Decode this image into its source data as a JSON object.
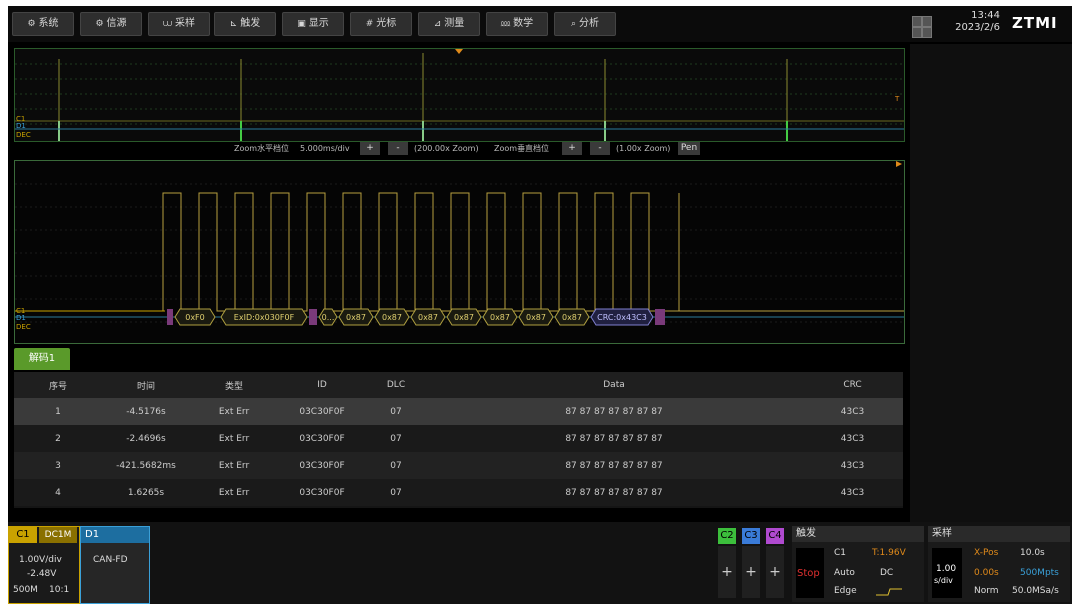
{
  "menu": [
    {
      "icon": "⚙",
      "label": "系统",
      "name": "menu-system"
    },
    {
      "icon": "⚙",
      "label": "信源",
      "name": "menu-source"
    },
    {
      "icon": "⩊",
      "label": "采样",
      "name": "menu-sampling"
    },
    {
      "icon": "⊾",
      "label": "触发",
      "name": "menu-trigger"
    },
    {
      "icon": "▣",
      "label": "显示",
      "name": "menu-display"
    },
    {
      "icon": "#",
      "label": "光标",
      "name": "menu-cursor"
    },
    {
      "icon": "⊿",
      "label": "测量",
      "name": "menu-measure"
    },
    {
      "icon": "⅏",
      "label": "数学",
      "name": "menu-math"
    },
    {
      "icon": "⌕",
      "label": "分析",
      "name": "menu-analysis"
    }
  ],
  "clock": {
    "time": "13:44",
    "date": "2023/2/6"
  },
  "logo": "ZTMI",
  "zoom": {
    "h_label": "Zoom水平档位",
    "h_value": "5.000ms/div",
    "plus": "+",
    "minus": "-",
    "h_factor": "(200.00x Zoom)",
    "v_label": "Zoom垂直档位",
    "v_factor": "(1.00x Zoom)",
    "pen": "Pen"
  },
  "overview": {
    "t_marker": "T"
  },
  "channel_tags": {
    "c1": "C1",
    "d1": "D1",
    "dec": "DEC"
  },
  "decode_segments": [
    "0xF0",
    "ExID:0x030F0F",
    "0...",
    "0x87",
    "0x87",
    "0x87",
    "0x87",
    "0x87",
    "0x87",
    "0x87",
    "CRC:0x43C3"
  ],
  "decode_tab": "解码1",
  "table": {
    "headers": [
      "序号",
      "时间",
      "类型",
      "ID",
      "DLC",
      "Data",
      "CRC"
    ],
    "rows": [
      [
        "1",
        "-4.5176s",
        "Ext Err",
        "03C30F0F",
        "07",
        "87 87 87 87 87 87 87",
        "43C3"
      ],
      [
        "2",
        "-2.4696s",
        "Ext Err",
        "03C30F0F",
        "07",
        "87 87 87 87 87 87 87",
        "43C3"
      ],
      [
        "3",
        "-421.5682ms",
        "Ext Err",
        "03C30F0F",
        "07",
        "87 87 87 87 87 87 87",
        "43C3"
      ],
      [
        "4",
        "1.6265s",
        "Ext Err",
        "03C30F0F",
        "07",
        "87 87 87 87 87 87 87",
        "43C3"
      ]
    ]
  },
  "c1": {
    "label": "C1",
    "coupling": "DC1M",
    "vdiv": "1.00V/div",
    "offset": "-2.48V",
    "bw": "500M",
    "probe": "10:1",
    "color": "#c9a200"
  },
  "d1": {
    "label": "D1",
    "protocol": "CAN-FD",
    "color": "#3aa0d8"
  },
  "channels": [
    {
      "label": "C2",
      "color": "#3cbf3c"
    },
    {
      "label": "C3",
      "color": "#3a7bd8"
    },
    {
      "label": "C4",
      "color": "#b04ad0"
    }
  ],
  "plus_label": "+",
  "trigger": {
    "title": "触发",
    "state": "Stop",
    "source": "C1",
    "level": "T:1.96V",
    "mode": "Auto",
    "coupling": "DC",
    "type": "Edge"
  },
  "acquire": {
    "title": "采样",
    "timebase": "1.00",
    "timebase_unit": "s/div",
    "xpos_label": "X-Pos",
    "xpos": "10.0s",
    "offset": "0.00s",
    "mpts": "500Mpts",
    "mode": "Norm",
    "rate": "50.0MSa/s"
  }
}
